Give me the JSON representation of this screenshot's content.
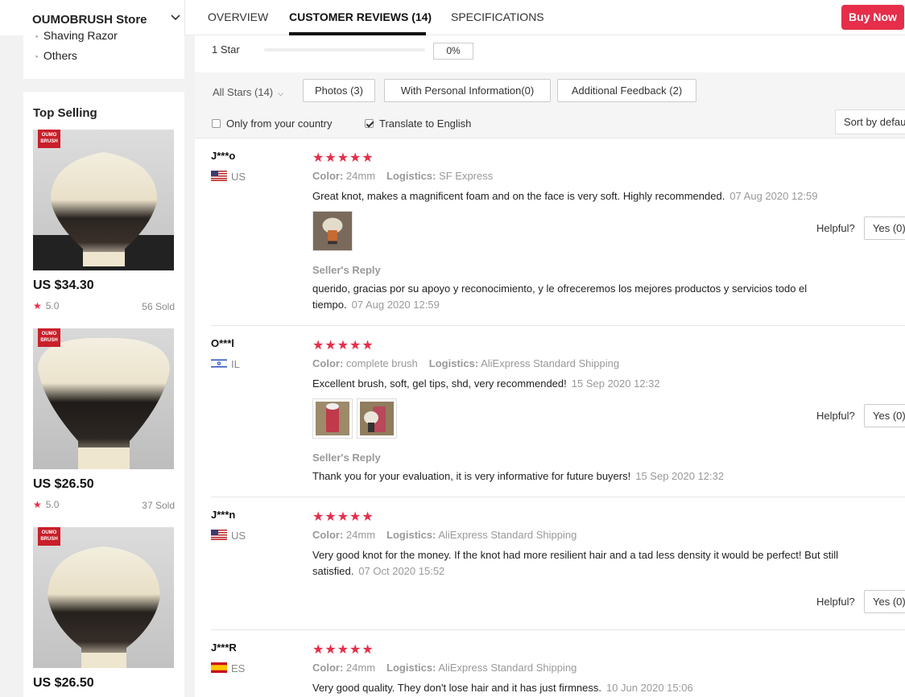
{
  "header": {
    "store_name": "OUMOBRUSH Store",
    "tabs": [
      {
        "label": "OVERVIEW",
        "active": false
      },
      {
        "label": "CUSTOMER REVIEWS (14)",
        "active": true
      },
      {
        "label": "SPECIFICATIONS",
        "active": false
      }
    ],
    "buy_now": "Buy Now",
    "accent_color": "#e62e4a"
  },
  "sidebar": {
    "categories": [
      "Shaving Razor",
      "Others"
    ],
    "top_selling_title": "Top Selling",
    "badge_text": "OUMO BRUSH",
    "products": [
      {
        "price": "US $34.30",
        "rating": "5.0",
        "sold": "56 Sold"
      },
      {
        "price": "US $26.50",
        "rating": "5.0",
        "sold": "37 Sold"
      },
      {
        "price": "US $26.50",
        "rating": "",
        "sold": ""
      }
    ]
  },
  "rating_summary": {
    "label": "1 Star",
    "percent": "0%",
    "fill_fraction": 0
  },
  "filters": {
    "all_stars": "All Stars (14)",
    "buttons": [
      "Photos (3)",
      "With Personal Information(0)",
      "Additional Feedback (2)"
    ],
    "only_country": {
      "label": "Only from your country",
      "checked": false
    },
    "translate": {
      "label": "Translate to English",
      "checked": true
    },
    "sort": "Sort by default"
  },
  "reviews": [
    {
      "user": "J***o",
      "country": "US",
      "stars": "★★★★★",
      "color_label": "Color:",
      "color": "24mm",
      "logistics_label": "Logistics:",
      "logistics": "SF Express",
      "text": "Great knot, makes a magnificent foam and on the face is very soft. Highly recommended.",
      "date": "07 Aug 2020 12:59",
      "helpful": "Helpful?",
      "yes": "Yes (0)",
      "seller_reply_label": "Seller's Reply",
      "reply": "querido, gracias por su apoyo y reconocimiento, y le ofreceremos los mejores productos y servicios todo el tiempo.",
      "reply_date": "07 Aug 2020 12:59"
    },
    {
      "user": "O***l",
      "country": "IL",
      "stars": "★★★★★",
      "color_label": "Color:",
      "color": "complete brush",
      "logistics_label": "Logistics:",
      "logistics": "AliExpress Standard Shipping",
      "text": "Excellent brush, soft, gel tips, shd, very recommended!",
      "date": "15 Sep 2020 12:32",
      "helpful": "Helpful?",
      "yes": "Yes (0)",
      "seller_reply_label": "Seller's Reply",
      "reply": "Thank you for your evaluation, it is very informative for future buyers!",
      "reply_date": "15 Sep 2020 12:32"
    },
    {
      "user": "J***n",
      "country": "US",
      "stars": "★★★★★",
      "color_label": "Color:",
      "color": "24mm",
      "logistics_label": "Logistics:",
      "logistics": "AliExpress Standard Shipping",
      "text": "Very good knot for the money. If the knot had more resilient hair and a tad less density it would be perfect! But still satisfied.",
      "date": "07 Oct 2020 15:52",
      "helpful": "Helpful?",
      "yes": "Yes (0)"
    },
    {
      "user": "J***R",
      "country": "ES",
      "stars": "★★★★★",
      "color_label": "Color:",
      "color": "24mm",
      "logistics_label": "Logistics:",
      "logistics": "AliExpress Standard Shipping",
      "text": "Very good quality. They don't lose hair and it has just firmness.",
      "date": "10 Jun 2020 15:06"
    }
  ]
}
